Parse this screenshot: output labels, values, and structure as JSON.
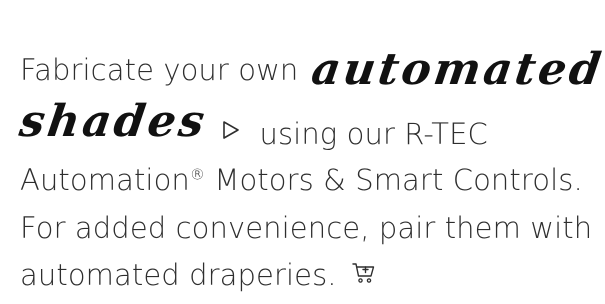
{
  "colors": {
    "text": "#2e2e2e",
    "script": "#111111",
    "background": "#ffffff"
  },
  "promo": {
    "line1_text": "Fabricate your own",
    "line1_script": "automated",
    "line2_script": "shades",
    "line2_text": "using our R-TEC",
    "line3_text_a": "Automation",
    "line3_reg": "®",
    "line3_text_b": " Motors & Smart Controls.",
    "line4_text": "For added convenience, pair them with",
    "line5_text": "automated draperies."
  },
  "icons": {
    "play": "play-triangle-outline-icon",
    "cart": "shopping-cart-add-icon"
  }
}
